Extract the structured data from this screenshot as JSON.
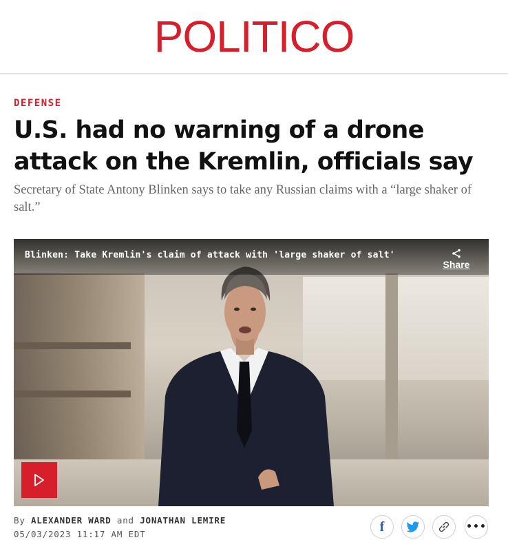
{
  "masthead": {
    "logo": "POLITICO",
    "brand_color": "#d71e2b"
  },
  "article": {
    "section": "DEFENSE",
    "headline": "U.S. had no warning of a drone attack on the Kremlin, officials say",
    "dek": "Secretary of State Antony Blinken says to take any Russian claims with a “large shaker of salt.”"
  },
  "video": {
    "title": "Blinken: Take Kremlin's claim of attack with 'large shaker of salt'",
    "share_label": "Share",
    "play_icon": "play-icon"
  },
  "byline": {
    "prefix": "By",
    "author1": "ALEXANDER WARD",
    "conjunction": "and",
    "author2": "JONATHAN LEMIRE",
    "date": "05/03/2023 11:17 AM EDT"
  },
  "social": {
    "facebook_icon": "facebook-icon",
    "twitter_icon": "twitter-icon",
    "link_icon": "link-icon",
    "more_icon": "more-icon",
    "facebook_glyph": "f",
    "more_glyph": "•••",
    "facebook_color": "#2b5fb0",
    "twitter_color": "#1d9bf0"
  }
}
